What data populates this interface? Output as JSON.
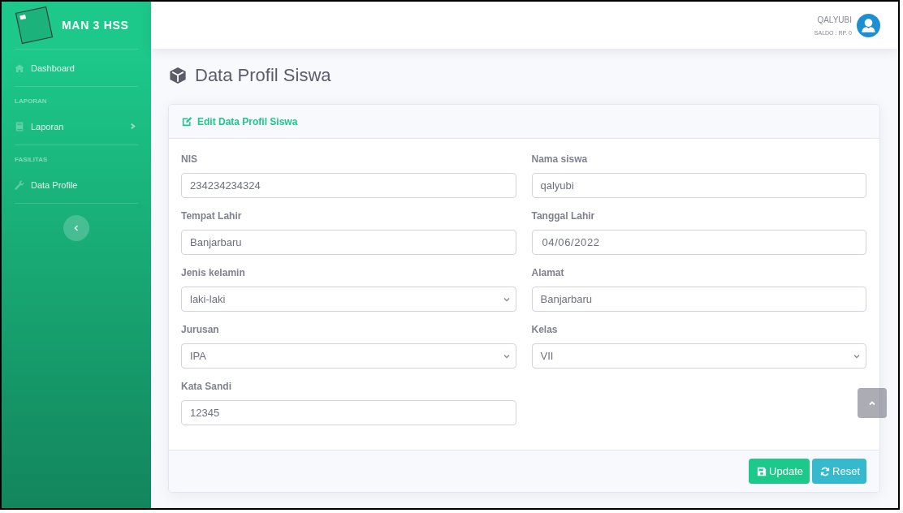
{
  "sidebar": {
    "brand": "MAN 3 HSS",
    "items": [
      {
        "kind": "link",
        "label": "Dashboard"
      },
      {
        "kind": "heading",
        "label": "LAPORAN"
      },
      {
        "kind": "collapse",
        "label": "Laporan",
        "expanded": false
      },
      {
        "kind": "heading",
        "label": "FASILITAS"
      },
      {
        "kind": "link",
        "label": "Data Profile"
      }
    ]
  },
  "topbar": {
    "user_name": "QALYUBI",
    "balance": "SALDO : RP. 0"
  },
  "page_heading": "Data Profil Siswa",
  "card": {
    "title": "Edit Data Profil Siswa",
    "fields": [
      {
        "kind": "text",
        "label": "NIS",
        "value": "234234234324"
      },
      {
        "kind": "text",
        "label": "Nama siswa",
        "value": "qalyubi"
      },
      {
        "kind": "text",
        "label": "Tempat Lahir",
        "value": "Banjarbaru"
      },
      {
        "kind": "date",
        "label": "Tanggal Lahir",
        "value": "04/06/2022"
      },
      {
        "kind": "select",
        "label": "Jenis kelamin",
        "value": "laki-laki"
      },
      {
        "kind": "text",
        "label": "Alamat",
        "value": "Banjarbaru"
      },
      {
        "kind": "select",
        "label": "Jurusan",
        "value": "IPA"
      },
      {
        "kind": "select",
        "label": "Kelas",
        "value": "VII"
      },
      {
        "kind": "text",
        "label": "Kata Sandi",
        "value": "12345"
      }
    ],
    "buttons": [
      {
        "kind": "success",
        "label": "Update"
      },
      {
        "kind": "info",
        "label": "Reset"
      }
    ]
  }
}
